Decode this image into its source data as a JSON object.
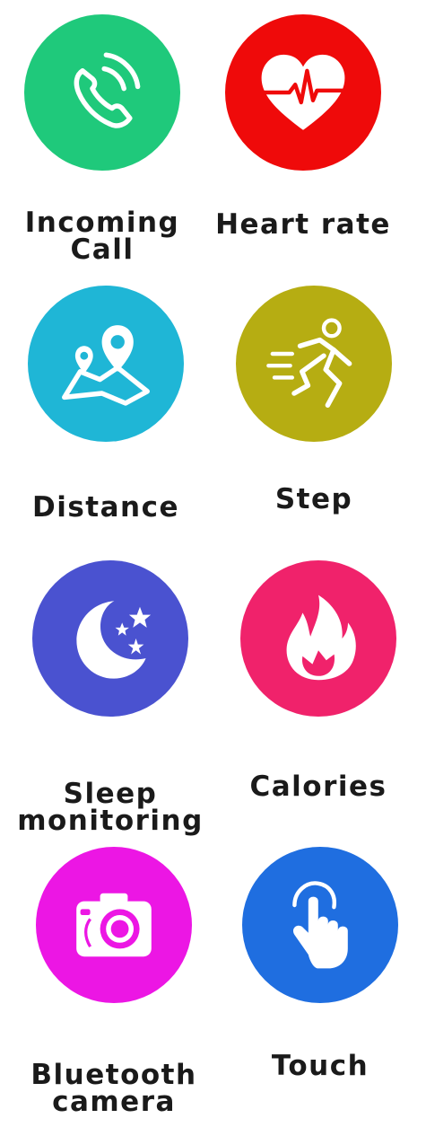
{
  "features": [
    {
      "id": "incoming-call",
      "label": "Incoming\nCall",
      "color": "#1fc97b",
      "icon": "phone-icon"
    },
    {
      "id": "heart-rate",
      "label": "Heart rate",
      "color": "#ef0a0a",
      "icon": "heart-pulse-icon"
    },
    {
      "id": "distance",
      "label": "Distance",
      "color": "#1fb6d6",
      "icon": "map-pin-icon"
    },
    {
      "id": "step",
      "label": "Step",
      "color": "#b6ad12",
      "icon": "runner-icon"
    },
    {
      "id": "sleep-monitoring",
      "label": "Sleep\nmonitoring",
      "color": "#4a52d0",
      "icon": "moon-stars-icon"
    },
    {
      "id": "calories",
      "label": "Calories",
      "color": "#f0226b",
      "icon": "flame-icon"
    },
    {
      "id": "bluetooth-camera",
      "label": "Bluetooth\ncamera",
      "color": "#ec16e4",
      "icon": "camera-icon"
    },
    {
      "id": "touch",
      "label": "Touch",
      "color": "#1f6ee0",
      "icon": "touch-hand-icon"
    }
  ]
}
